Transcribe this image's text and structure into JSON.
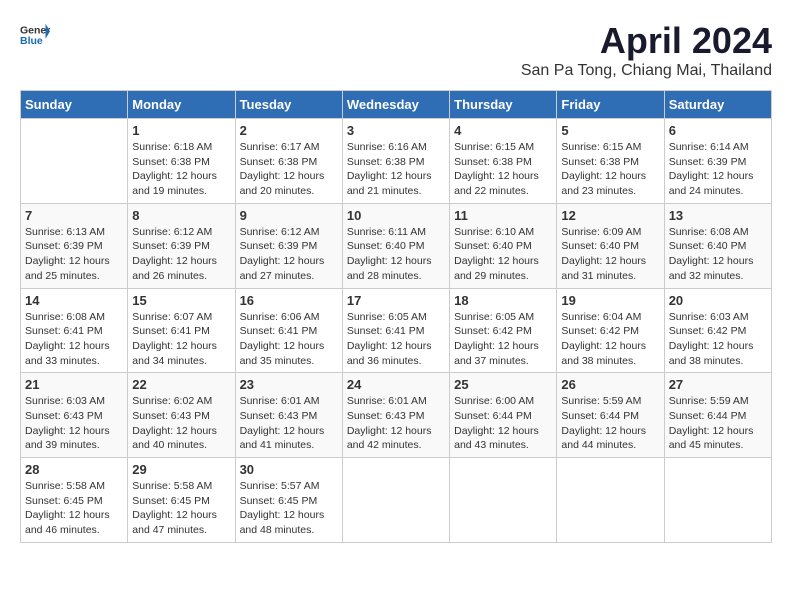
{
  "header": {
    "logo_general": "General",
    "logo_blue": "Blue",
    "title": "April 2024",
    "subtitle": "San Pa Tong, Chiang Mai, Thailand"
  },
  "calendar": {
    "days_of_week": [
      "Sunday",
      "Monday",
      "Tuesday",
      "Wednesday",
      "Thursday",
      "Friday",
      "Saturday"
    ],
    "weeks": [
      [
        {
          "day": "",
          "sunrise": "",
          "sunset": "",
          "daylight": ""
        },
        {
          "day": "1",
          "sunrise": "Sunrise: 6:18 AM",
          "sunset": "Sunset: 6:38 PM",
          "daylight": "Daylight: 12 hours and 19 minutes."
        },
        {
          "day": "2",
          "sunrise": "Sunrise: 6:17 AM",
          "sunset": "Sunset: 6:38 PM",
          "daylight": "Daylight: 12 hours and 20 minutes."
        },
        {
          "day": "3",
          "sunrise": "Sunrise: 6:16 AM",
          "sunset": "Sunset: 6:38 PM",
          "daylight": "Daylight: 12 hours and 21 minutes."
        },
        {
          "day": "4",
          "sunrise": "Sunrise: 6:15 AM",
          "sunset": "Sunset: 6:38 PM",
          "daylight": "Daylight: 12 hours and 22 minutes."
        },
        {
          "day": "5",
          "sunrise": "Sunrise: 6:15 AM",
          "sunset": "Sunset: 6:38 PM",
          "daylight": "Daylight: 12 hours and 23 minutes."
        },
        {
          "day": "6",
          "sunrise": "Sunrise: 6:14 AM",
          "sunset": "Sunset: 6:39 PM",
          "daylight": "Daylight: 12 hours and 24 minutes."
        }
      ],
      [
        {
          "day": "7",
          "sunrise": "Sunrise: 6:13 AM",
          "sunset": "Sunset: 6:39 PM",
          "daylight": "Daylight: 12 hours and 25 minutes."
        },
        {
          "day": "8",
          "sunrise": "Sunrise: 6:12 AM",
          "sunset": "Sunset: 6:39 PM",
          "daylight": "Daylight: 12 hours and 26 minutes."
        },
        {
          "day": "9",
          "sunrise": "Sunrise: 6:12 AM",
          "sunset": "Sunset: 6:39 PM",
          "daylight": "Daylight: 12 hours and 27 minutes."
        },
        {
          "day": "10",
          "sunrise": "Sunrise: 6:11 AM",
          "sunset": "Sunset: 6:40 PM",
          "daylight": "Daylight: 12 hours and 28 minutes."
        },
        {
          "day": "11",
          "sunrise": "Sunrise: 6:10 AM",
          "sunset": "Sunset: 6:40 PM",
          "daylight": "Daylight: 12 hours and 29 minutes."
        },
        {
          "day": "12",
          "sunrise": "Sunrise: 6:09 AM",
          "sunset": "Sunset: 6:40 PM",
          "daylight": "Daylight: 12 hours and 31 minutes."
        },
        {
          "day": "13",
          "sunrise": "Sunrise: 6:08 AM",
          "sunset": "Sunset: 6:40 PM",
          "daylight": "Daylight: 12 hours and 32 minutes."
        }
      ],
      [
        {
          "day": "14",
          "sunrise": "Sunrise: 6:08 AM",
          "sunset": "Sunset: 6:41 PM",
          "daylight": "Daylight: 12 hours and 33 minutes."
        },
        {
          "day": "15",
          "sunrise": "Sunrise: 6:07 AM",
          "sunset": "Sunset: 6:41 PM",
          "daylight": "Daylight: 12 hours and 34 minutes."
        },
        {
          "day": "16",
          "sunrise": "Sunrise: 6:06 AM",
          "sunset": "Sunset: 6:41 PM",
          "daylight": "Daylight: 12 hours and 35 minutes."
        },
        {
          "day": "17",
          "sunrise": "Sunrise: 6:05 AM",
          "sunset": "Sunset: 6:41 PM",
          "daylight": "Daylight: 12 hours and 36 minutes."
        },
        {
          "day": "18",
          "sunrise": "Sunrise: 6:05 AM",
          "sunset": "Sunset: 6:42 PM",
          "daylight": "Daylight: 12 hours and 37 minutes."
        },
        {
          "day": "19",
          "sunrise": "Sunrise: 6:04 AM",
          "sunset": "Sunset: 6:42 PM",
          "daylight": "Daylight: 12 hours and 38 minutes."
        },
        {
          "day": "20",
          "sunrise": "Sunrise: 6:03 AM",
          "sunset": "Sunset: 6:42 PM",
          "daylight": "Daylight: 12 hours and 38 minutes."
        }
      ],
      [
        {
          "day": "21",
          "sunrise": "Sunrise: 6:03 AM",
          "sunset": "Sunset: 6:43 PM",
          "daylight": "Daylight: 12 hours and 39 minutes."
        },
        {
          "day": "22",
          "sunrise": "Sunrise: 6:02 AM",
          "sunset": "Sunset: 6:43 PM",
          "daylight": "Daylight: 12 hours and 40 minutes."
        },
        {
          "day": "23",
          "sunrise": "Sunrise: 6:01 AM",
          "sunset": "Sunset: 6:43 PM",
          "daylight": "Daylight: 12 hours and 41 minutes."
        },
        {
          "day": "24",
          "sunrise": "Sunrise: 6:01 AM",
          "sunset": "Sunset: 6:43 PM",
          "daylight": "Daylight: 12 hours and 42 minutes."
        },
        {
          "day": "25",
          "sunrise": "Sunrise: 6:00 AM",
          "sunset": "Sunset: 6:44 PM",
          "daylight": "Daylight: 12 hours and 43 minutes."
        },
        {
          "day": "26",
          "sunrise": "Sunrise: 5:59 AM",
          "sunset": "Sunset: 6:44 PM",
          "daylight": "Daylight: 12 hours and 44 minutes."
        },
        {
          "day": "27",
          "sunrise": "Sunrise: 5:59 AM",
          "sunset": "Sunset: 6:44 PM",
          "daylight": "Daylight: 12 hours and 45 minutes."
        }
      ],
      [
        {
          "day": "28",
          "sunrise": "Sunrise: 5:58 AM",
          "sunset": "Sunset: 6:45 PM",
          "daylight": "Daylight: 12 hours and 46 minutes."
        },
        {
          "day": "29",
          "sunrise": "Sunrise: 5:58 AM",
          "sunset": "Sunset: 6:45 PM",
          "daylight": "Daylight: 12 hours and 47 minutes."
        },
        {
          "day": "30",
          "sunrise": "Sunrise: 5:57 AM",
          "sunset": "Sunset: 6:45 PM",
          "daylight": "Daylight: 12 hours and 48 minutes."
        },
        {
          "day": "",
          "sunrise": "",
          "sunset": "",
          "daylight": ""
        },
        {
          "day": "",
          "sunrise": "",
          "sunset": "",
          "daylight": ""
        },
        {
          "day": "",
          "sunrise": "",
          "sunset": "",
          "daylight": ""
        },
        {
          "day": "",
          "sunrise": "",
          "sunset": "",
          "daylight": ""
        }
      ]
    ]
  }
}
